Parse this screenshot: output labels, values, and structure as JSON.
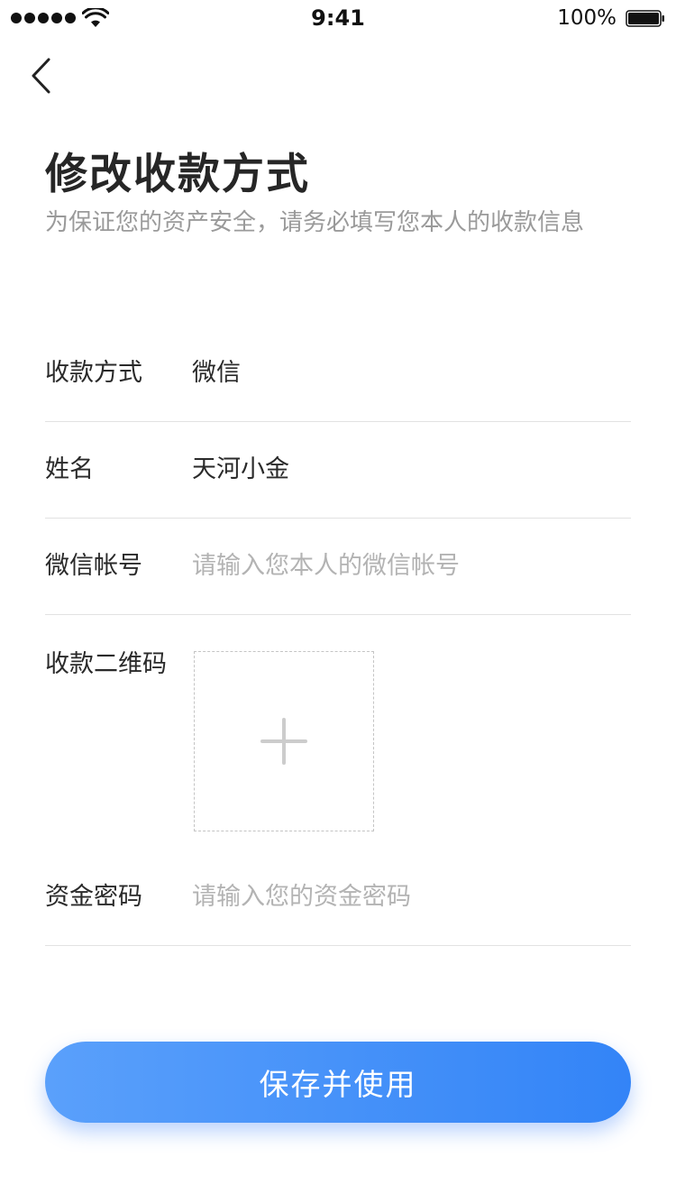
{
  "status_bar": {
    "time": "9:41",
    "battery": "100%"
  },
  "header": {
    "title": "修改收款方式",
    "subtitle": "为保证您的资产安全，请务必填写您本人的收款信息"
  },
  "form": {
    "method": {
      "label": "收款方式",
      "value": "微信"
    },
    "name": {
      "label": "姓名",
      "value": "天河小金"
    },
    "account": {
      "label": "微信帐号",
      "placeholder": "请输入您本人的微信帐号"
    },
    "qr": {
      "label": "收款二维码"
    },
    "password": {
      "label": "资金密码",
      "placeholder": "请输入您的资金密码"
    }
  },
  "actions": {
    "save_label": "保存并使用"
  },
  "colors": {
    "accent": "#3384f7",
    "accent_light": "#5aa0fb",
    "placeholder": "#b3b3b3",
    "divider": "#e2e2e2"
  },
  "icons": {
    "back": "chevron-left-icon",
    "upload": "plus-icon",
    "signal": "cellular-signal-icon",
    "wifi": "wifi-icon",
    "battery": "battery-icon"
  }
}
